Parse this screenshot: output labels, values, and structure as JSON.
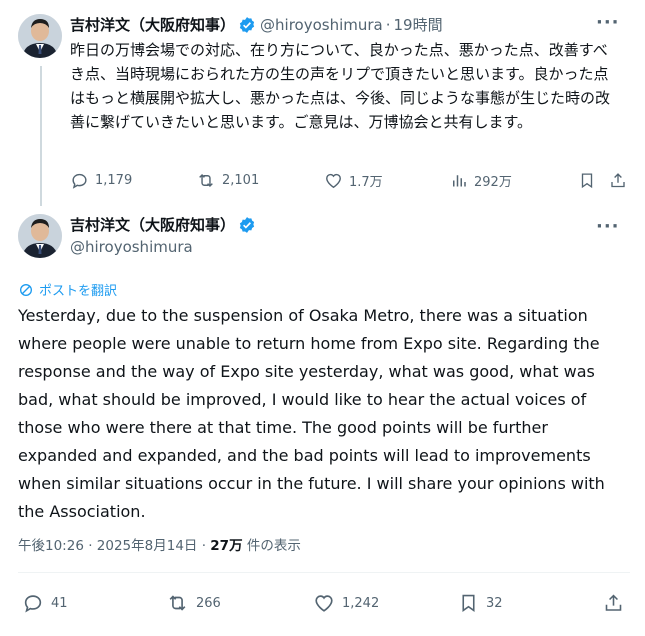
{
  "tweet1": {
    "display_name": "吉村洋文（大阪府知事）",
    "handle": "@hiroyoshimura",
    "separator": "·",
    "time": "19時間",
    "text": "昨日の万博会場での対応、在り方について、良かった点、悪かった点、改善すべき点、当時現場におられた方の生の声をリプで頂きたいと思います。良かった点はもっと横展開や拡大し、悪かった点は、今後、同じような事態が生じた時の改善に繋げていきたいと思います。ご意見は、万博協会と共有します。",
    "replies": "1,179",
    "reposts": "2,101",
    "likes": "1.7万",
    "views": "292万"
  },
  "tweet2": {
    "display_name": "吉村洋文（大阪府知事）",
    "handle": "@hiroyoshimura",
    "translate_label": "ポストを翻訳",
    "text": "Yesterday, due to the suspension of Osaka Metro, there was a situation where people were unable to return home from Expo site. Regarding the response and the way of Expo site yesterday, what was good, what was bad, what should be improved, I would like to hear the actual voices of those who were there at that time. The good points will be further expanded and expanded, and the bad points will lead to improvements when similar situations occur in the future. I will share your opinions with the Association.",
    "timestamp": "午後10:26 · 2025年8月14日 · ",
    "views_count": "27万",
    "views_label": " 件の表示",
    "replies": "41",
    "reposts": "266",
    "likes": "1,242",
    "bookmarks": "32"
  },
  "colors": {
    "text": "#0f1419",
    "secondary": "#536471",
    "accent": "#1d9bf0",
    "divider": "#eff3f4"
  },
  "icons": [
    "verified-badge-icon",
    "more-icon",
    "reply-icon",
    "repost-icon",
    "like-icon",
    "views-icon",
    "bookmark-icon",
    "share-icon",
    "translate-icon"
  ]
}
